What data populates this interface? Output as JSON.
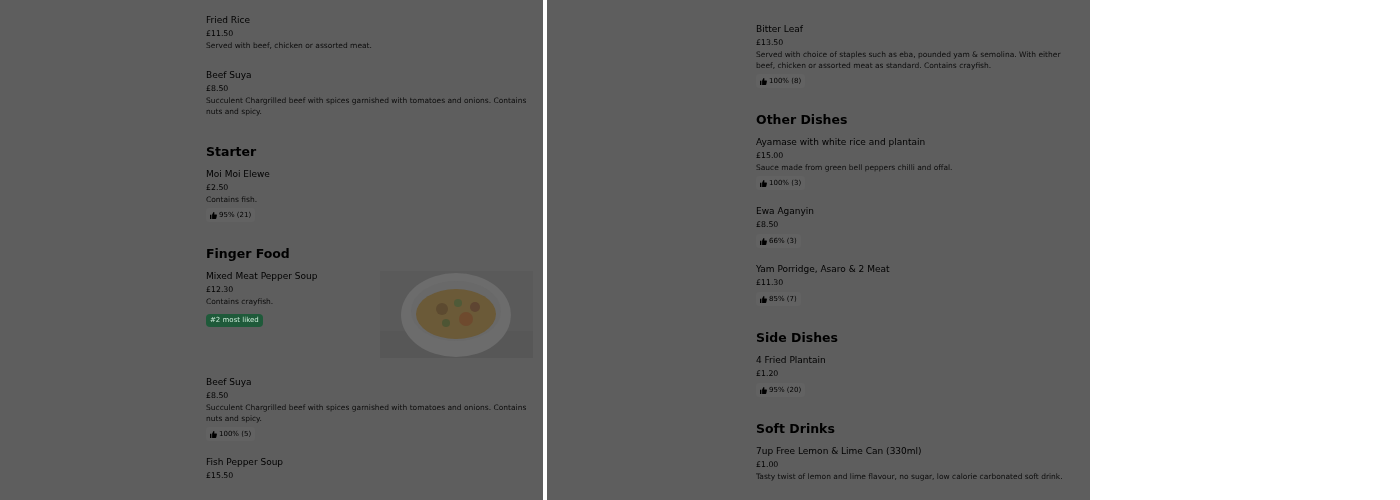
{
  "panels": [
    {
      "sections": [
        {
          "items": [
            {
              "name": "Fried Rice",
              "price": "£11.50",
              "description": "Served with beef, chicken or assorted meat."
            },
            {
              "name": "Beef Suya",
              "price": "£8.50",
              "description": "Succulent Chargrilled beef with spices garnished with tomatoes and onions. Contains nuts and spicy."
            }
          ]
        },
        {
          "heading": "Starter",
          "items": [
            {
              "name": "Moi Moi Elewe",
              "price": "£2.50",
              "description": "Contains fish.",
              "rating": "95% (21)"
            }
          ]
        },
        {
          "heading": "Finger Food",
          "items": [
            {
              "name": "Mixed Meat Pepper Soup",
              "price": "£12.30",
              "description": "Contains crayfish.",
              "badge": "#2 most liked",
              "kind": "picture"
            },
            {
              "name": "Beef Suya",
              "price": "£8.50",
              "description": "Succulent Chargrilled beef with spices garnished with tomatoes and onions. Contains nuts and spicy.",
              "rating": "100% (5)"
            },
            {
              "name": "Fish Pepper Soup",
              "price": "£15.50"
            }
          ]
        }
      ]
    },
    {
      "sections": [
        {
          "items": [
            {
              "name": "Bitter Leaf",
              "price": "£13.50",
              "description": "Served with choice of staples such as eba, pounded yam & semolina. With either beef, chicken or assorted meat as standard. Contains crayfish.",
              "rating": "100% (8)"
            }
          ]
        },
        {
          "heading": "Other Dishes",
          "items": [
            {
              "name": "Ayamase with white rice and plantain",
              "price": "£15.00",
              "description": "Sauce made from green bell peppers chilli and offal.",
              "rating": "100% (3)"
            },
            {
              "name": "Ewa Aganyin",
              "price": "£8.50",
              "rating": "66% (3)"
            },
            {
              "name": "Yam Porridge, Asaro & 2 Meat",
              "price": "£11.30",
              "rating": "85% (7)"
            }
          ]
        },
        {
          "heading": "Side Dishes",
          "items": [
            {
              "name": "4 Fried Plantain",
              "price": "£1.20",
              "rating": "95% (20)"
            }
          ]
        },
        {
          "heading": "Soft Drinks",
          "items": [
            {
              "name": "7up Free Lemon & Lime Can (330ml)",
              "price": "£1.00",
              "description": "Tasty twist of lemon and lime flavour, no sugar, low calorie carbonated soft drink."
            }
          ]
        }
      ]
    }
  ]
}
